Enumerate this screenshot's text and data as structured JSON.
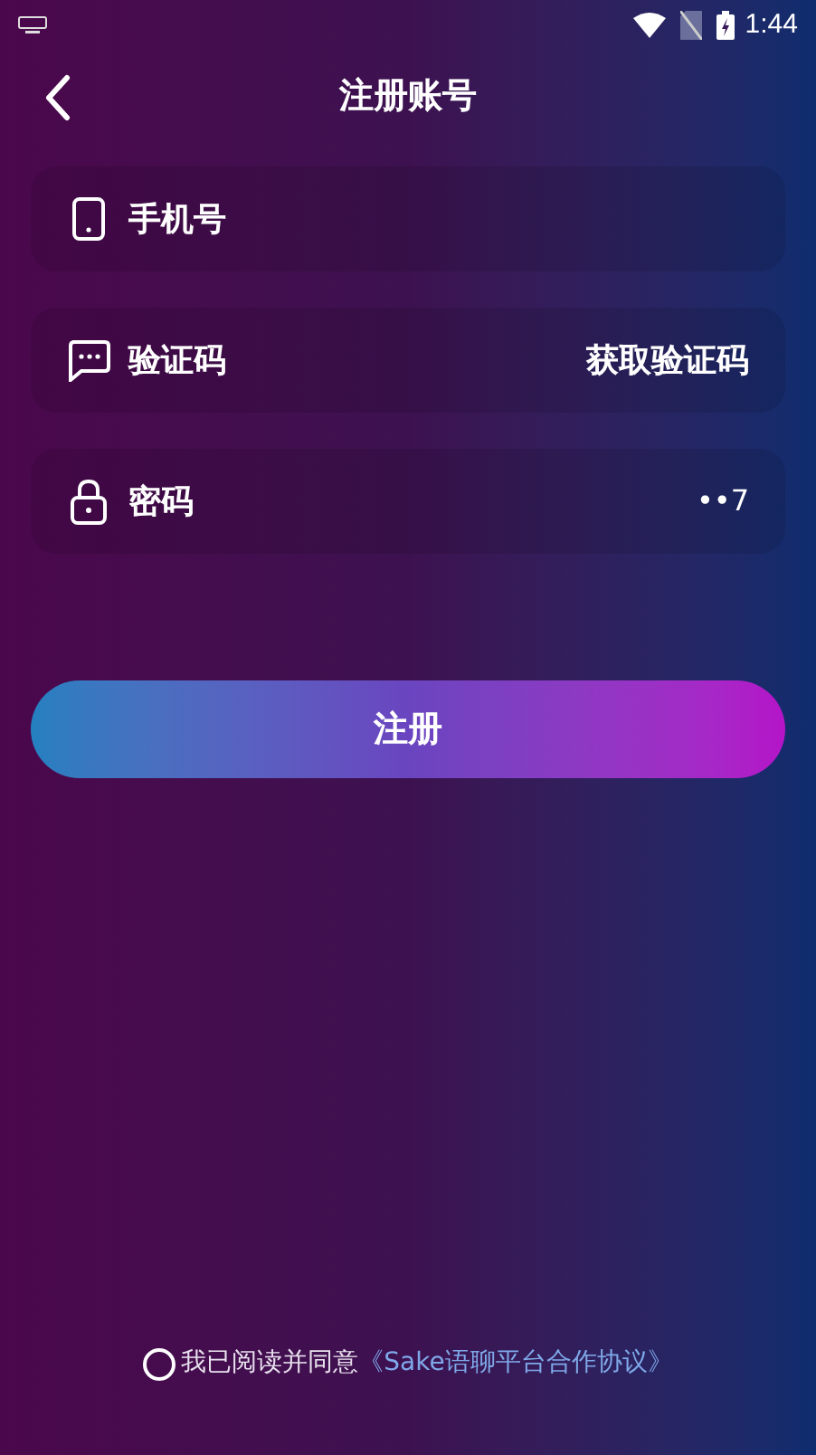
{
  "status_bar": {
    "time": "1:44"
  },
  "header": {
    "title": "注册账号"
  },
  "fields": [
    {
      "kind": "phone",
      "label": "手机号"
    },
    {
      "kind": "code",
      "label": "验证码",
      "action": "获取验证码"
    },
    {
      "kind": "password",
      "label": "密码",
      "value": "••7"
    }
  ],
  "submit": {
    "label": "注册"
  },
  "agreement": {
    "checked": false,
    "text": "我已阅读并同意",
    "link": "《Sake语聊平台合作协议》"
  }
}
